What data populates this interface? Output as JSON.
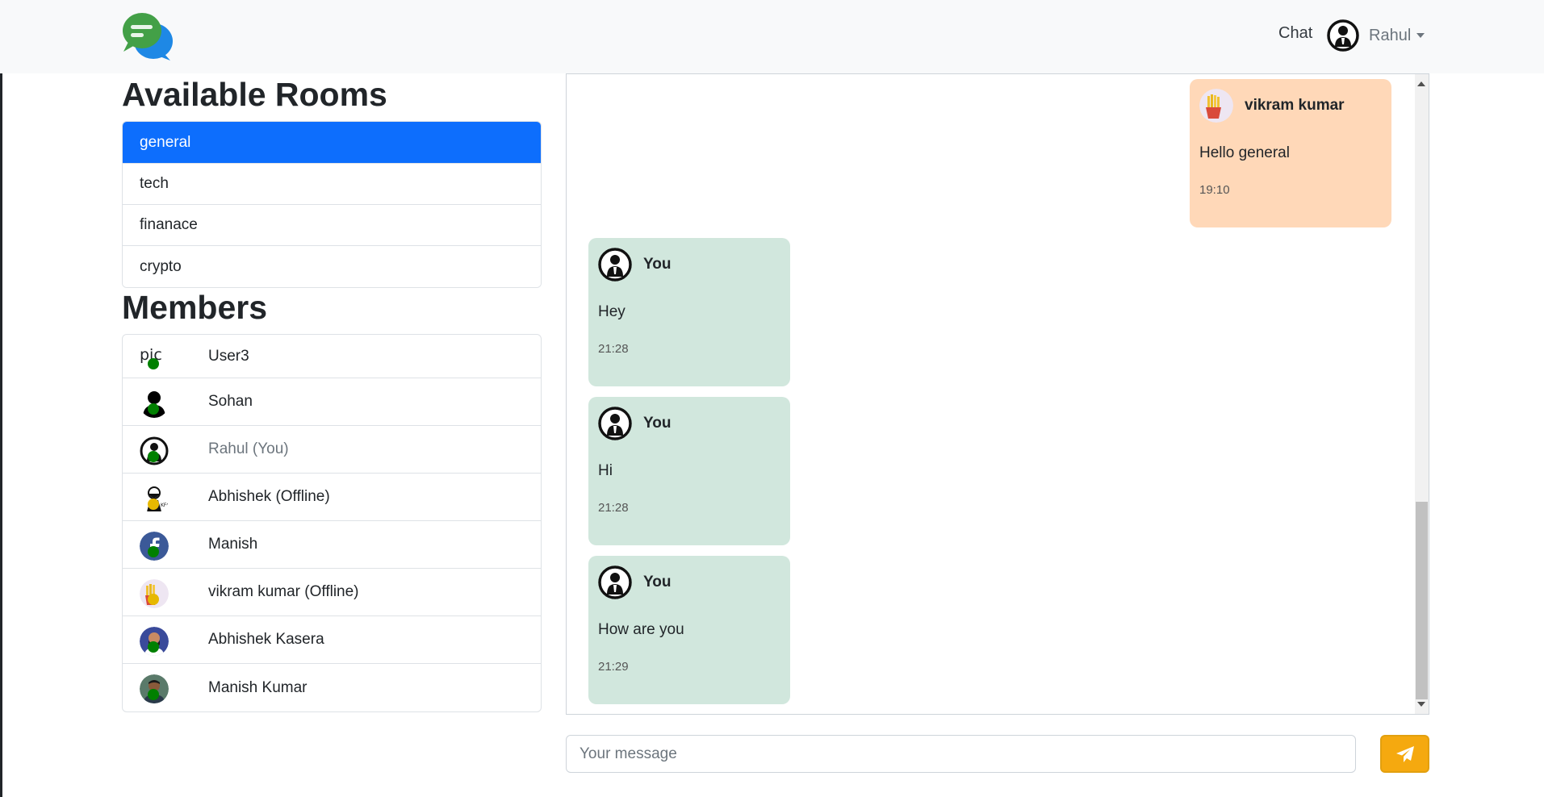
{
  "navbar": {
    "logo_icon": "chat-bubbles-logo",
    "chat_link": "Chat",
    "user_name": "Rahul",
    "user_avatar_icon": "user-avatar-icon"
  },
  "rooms": {
    "title": "Available Rooms",
    "items": [
      {
        "label": "general",
        "active": true
      },
      {
        "label": "tech",
        "active": false
      },
      {
        "label": "finanace",
        "active": false
      },
      {
        "label": "crypto",
        "active": false
      }
    ]
  },
  "members": {
    "title": "Members",
    "items": [
      {
        "name": "User3",
        "avatar": "broken-image",
        "avatar_alt": "pic",
        "status": "online"
      },
      {
        "name": "Sohan",
        "avatar": "silhouette",
        "status": "online"
      },
      {
        "name": "Rahul (You)",
        "avatar": "suit-avatar",
        "status": "online"
      },
      {
        "name": "Abhishek (Offline)",
        "avatar": "kfc-logo",
        "status": "offline"
      },
      {
        "name": "Manish",
        "avatar": "facebook-logo",
        "status": "online"
      },
      {
        "name": "vikram kumar (Offline)",
        "avatar": "fries-photo",
        "status": "offline"
      },
      {
        "name": "Abhishek Kasera",
        "avatar": "photo",
        "status": "online"
      },
      {
        "name": "Manish Kumar",
        "avatar": "photo",
        "status": "online"
      }
    ]
  },
  "messages": [
    {
      "sender": "vikram kumar",
      "text": "Hello general",
      "time": "19:10",
      "own": false
    },
    {
      "sender": "You",
      "text": "Hey",
      "time": "21:28",
      "own": true
    },
    {
      "sender": "You",
      "text": "Hi",
      "time": "21:28",
      "own": true
    },
    {
      "sender": "You",
      "text": "How are you",
      "time": "21:29",
      "own": true
    }
  ],
  "composer": {
    "placeholder": "Your message",
    "value": "",
    "send_icon": "paper-plane-icon"
  },
  "colors": {
    "active_room": "#0d6efd",
    "online_dot": "#008000",
    "offline_dot": "#e6b800",
    "own_bubble": "#d1e7dd",
    "incoming_bubble": "#ffd8b8",
    "send_button": "#f5a90f"
  }
}
